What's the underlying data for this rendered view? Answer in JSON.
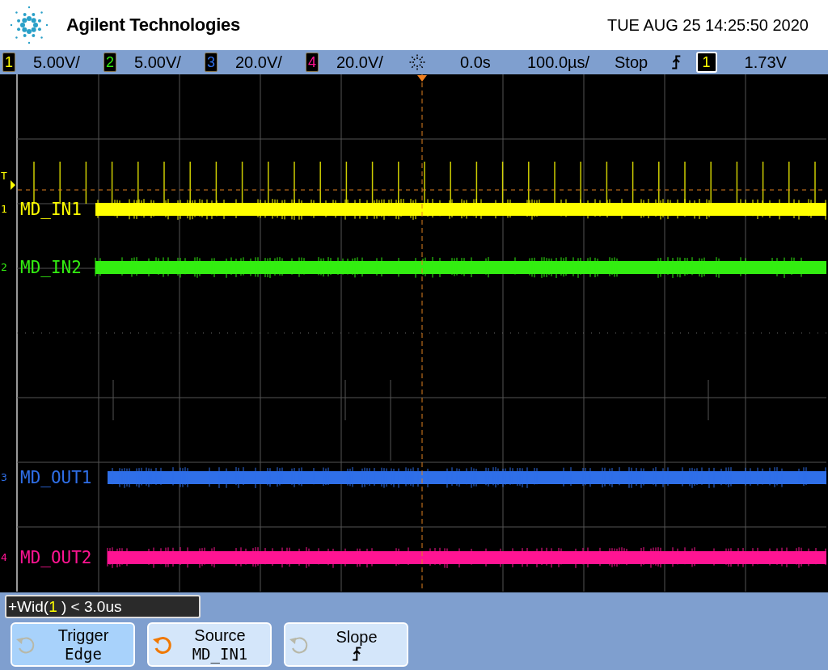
{
  "header": {
    "brand": "Agilent Technologies",
    "datetime": "TUE AUG 25 14:25:50 2020"
  },
  "status_bar": {
    "channels": [
      {
        "number": "1",
        "scale": "5.00V/"
      },
      {
        "number": "2",
        "scale": "5.00V/"
      },
      {
        "number": "3",
        "scale": "20.0V/"
      },
      {
        "number": "4",
        "scale": "20.0V/"
      }
    ],
    "time_offset": "0.0s",
    "timebase": "100.0µs/",
    "run_state": "Stop",
    "trigger_source": "1",
    "trigger_level": "1.73V"
  },
  "display": {
    "trigger_marker": "T",
    "traces": [
      {
        "number": "1",
        "label": "MD_IN1",
        "color": "#ffff00",
        "spikes": true
      },
      {
        "number": "2",
        "label": "MD_IN2",
        "color": "#33ee11",
        "spikes": false
      },
      {
        "number": "3",
        "label": "MD_OUT1",
        "color": "#2f6fe8",
        "spikes": false
      },
      {
        "number": "4",
        "label": "MD_OUT2",
        "color": "#ff1493",
        "spikes": false
      }
    ]
  },
  "trigger_info": {
    "prefix": "+Wid(",
    "source": "1",
    "suffix": " ) < 3.0us"
  },
  "softkeys": [
    {
      "label": "Trigger",
      "value": "Edge",
      "kind": "text",
      "selected": true,
      "knob_active": false
    },
    {
      "label": "Source",
      "value": "MD_IN1",
      "kind": "text",
      "selected": false,
      "knob_active": true
    },
    {
      "label": "Slope",
      "kind": "slope",
      "selected": false,
      "knob_active": false
    }
  ]
}
